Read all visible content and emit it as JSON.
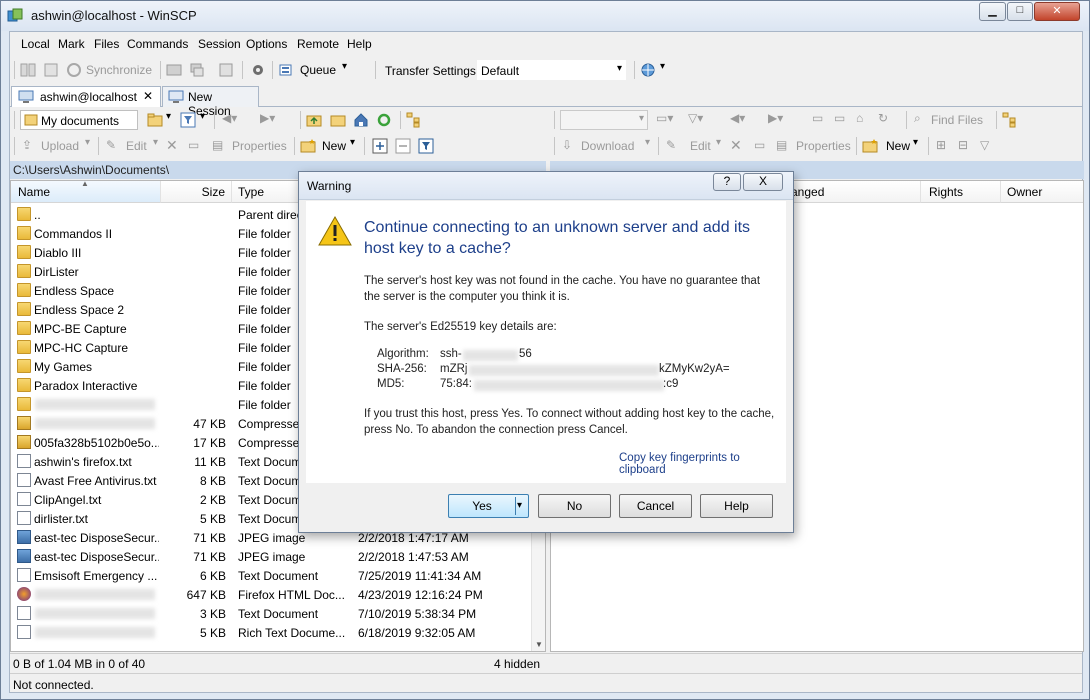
{
  "window": {
    "title": "ashwin@localhost - WinSCP"
  },
  "menu": [
    "Local",
    "Mark",
    "Files",
    "Commands",
    "Session",
    "Options",
    "Remote",
    "Help"
  ],
  "toolbar": {
    "synchronize_label": "Synchronize",
    "queue_label": "Queue",
    "transfer_settings_label": "Transfer Settings",
    "transfer_settings_value": "Default"
  },
  "tabs": [
    {
      "label": "ashwin@localhost"
    },
    {
      "label": "New Session"
    }
  ],
  "left_toolbar": {
    "location": "My documents",
    "upload": "Upload",
    "edit": "Edit",
    "properties": "Properties",
    "new": "New"
  },
  "right_toolbar": {
    "find_files": "Find Files",
    "download": "Download",
    "edit": "Edit",
    "properties": "Properties",
    "new": "New"
  },
  "left_path": "C:\\Users\\Ashwin\\Documents\\",
  "left_columns": {
    "name": "Name",
    "size": "Size",
    "type": "Type"
  },
  "right_columns": {
    "changed": "anged",
    "rights": "Rights",
    "owner": "Owner"
  },
  "files": [
    {
      "name": "..",
      "size": "",
      "type": "Parent direc",
      "changed": "",
      "icon": "parent-folder"
    },
    {
      "name": "Commandos II",
      "size": "",
      "type": "File folder",
      "changed": "",
      "icon": "folder"
    },
    {
      "name": "Diablo III",
      "size": "",
      "type": "File folder",
      "changed": "",
      "icon": "folder"
    },
    {
      "name": "DirLister",
      "size": "",
      "type": "File folder",
      "changed": "",
      "icon": "folder"
    },
    {
      "name": "Endless Space",
      "size": "",
      "type": "File folder",
      "changed": "",
      "icon": "folder"
    },
    {
      "name": "Endless Space 2",
      "size": "",
      "type": "File folder",
      "changed": "",
      "icon": "folder"
    },
    {
      "name": "MPC-BE Capture",
      "size": "",
      "type": "File folder",
      "changed": "",
      "icon": "folder"
    },
    {
      "name": "MPC-HC Capture",
      "size": "",
      "type": "File folder",
      "changed": "",
      "icon": "folder"
    },
    {
      "name": "My Games",
      "size": "",
      "type": "File folder",
      "changed": "",
      "icon": "folder"
    },
    {
      "name": "Paradox Interactive",
      "size": "",
      "type": "File folder",
      "changed": "",
      "icon": "folder"
    },
    {
      "name": "",
      "size": "",
      "type": "File folder",
      "changed": "",
      "icon": "folder"
    },
    {
      "name": "",
      "size": "47 KB",
      "type": "Compresse",
      "changed": "",
      "icon": "zip"
    },
    {
      "name": "005fa328b5102b0e5o...",
      "size": "17 KB",
      "type": "Compresse",
      "changed": "",
      "icon": "zip"
    },
    {
      "name": "ashwin's firefox.txt",
      "size": "11 KB",
      "type": "Text Docum",
      "changed": "",
      "icon": "doc"
    },
    {
      "name": "Avast Free Antivirus.txt",
      "size": "8 KB",
      "type": "Text Docum",
      "changed": "",
      "icon": "doc"
    },
    {
      "name": "ClipAngel.txt",
      "size": "2 KB",
      "type": "Text Docum",
      "changed": "",
      "icon": "doc"
    },
    {
      "name": "dirlister.txt",
      "size": "5 KB",
      "type": "Text Docum",
      "changed": "",
      "icon": "doc"
    },
    {
      "name": "east-tec DisposeSecur...",
      "size": "71 KB",
      "type": "JPEG image",
      "changed": "2/2/2018  1:47:17 AM",
      "icon": "image"
    },
    {
      "name": "east-tec DisposeSecur...",
      "size": "71 KB",
      "type": "JPEG image",
      "changed": "2/2/2018  1:47:53 AM",
      "icon": "image"
    },
    {
      "name": "Emsisoft Emergency ...",
      "size": "6 KB",
      "type": "Text Document",
      "changed": "7/25/2019  11:41:34 AM",
      "icon": "doc"
    },
    {
      "name": "",
      "size": "647 KB",
      "type": "Firefox HTML Doc...",
      "changed": "4/23/2019  12:16:24 PM",
      "icon": "firefox"
    },
    {
      "name": "",
      "size": "3 KB",
      "type": "Text Document",
      "changed": "7/10/2019  5:38:34 PM",
      "icon": "doc"
    },
    {
      "name": "",
      "size": "5 KB",
      "type": "Rich Text Docume...",
      "changed": "6/18/2019  9:32:05 AM",
      "icon": "doc"
    }
  ],
  "status": {
    "selection": "0 B of 1.04 MB in 0 of 40",
    "hidden": "4 hidden",
    "connection": "Not connected."
  },
  "dialog": {
    "title": "Warning",
    "help_button": "?",
    "close_button": "X",
    "heading": "Continue connecting to an unknown server and add its host key to a cache?",
    "paragraph1": "The server's host key was not found in the cache. You have no guarantee that the server is the computer you think it is.",
    "paragraph2": "The server's Ed25519 key details are:",
    "algorithm_label": "Algorithm:",
    "algorithm_value_start": "ssh-",
    "algorithm_value_end": "56",
    "sha_label": "SHA-256:",
    "sha_value_start": "mZRj",
    "sha_value_end": "kZMyKw2yA=",
    "md5_label": "MD5:",
    "md5_value_start": "75:84:",
    "md5_value_end": ":c9",
    "paragraph3": "If you trust this host, press Yes. To connect without adding host key to the cache, press No. To abandon the connection press Cancel.",
    "copy_link": "Copy key fingerprints to clipboard",
    "buttons": {
      "yes": "Yes",
      "no": "No",
      "cancel": "Cancel",
      "help": "Help"
    }
  }
}
